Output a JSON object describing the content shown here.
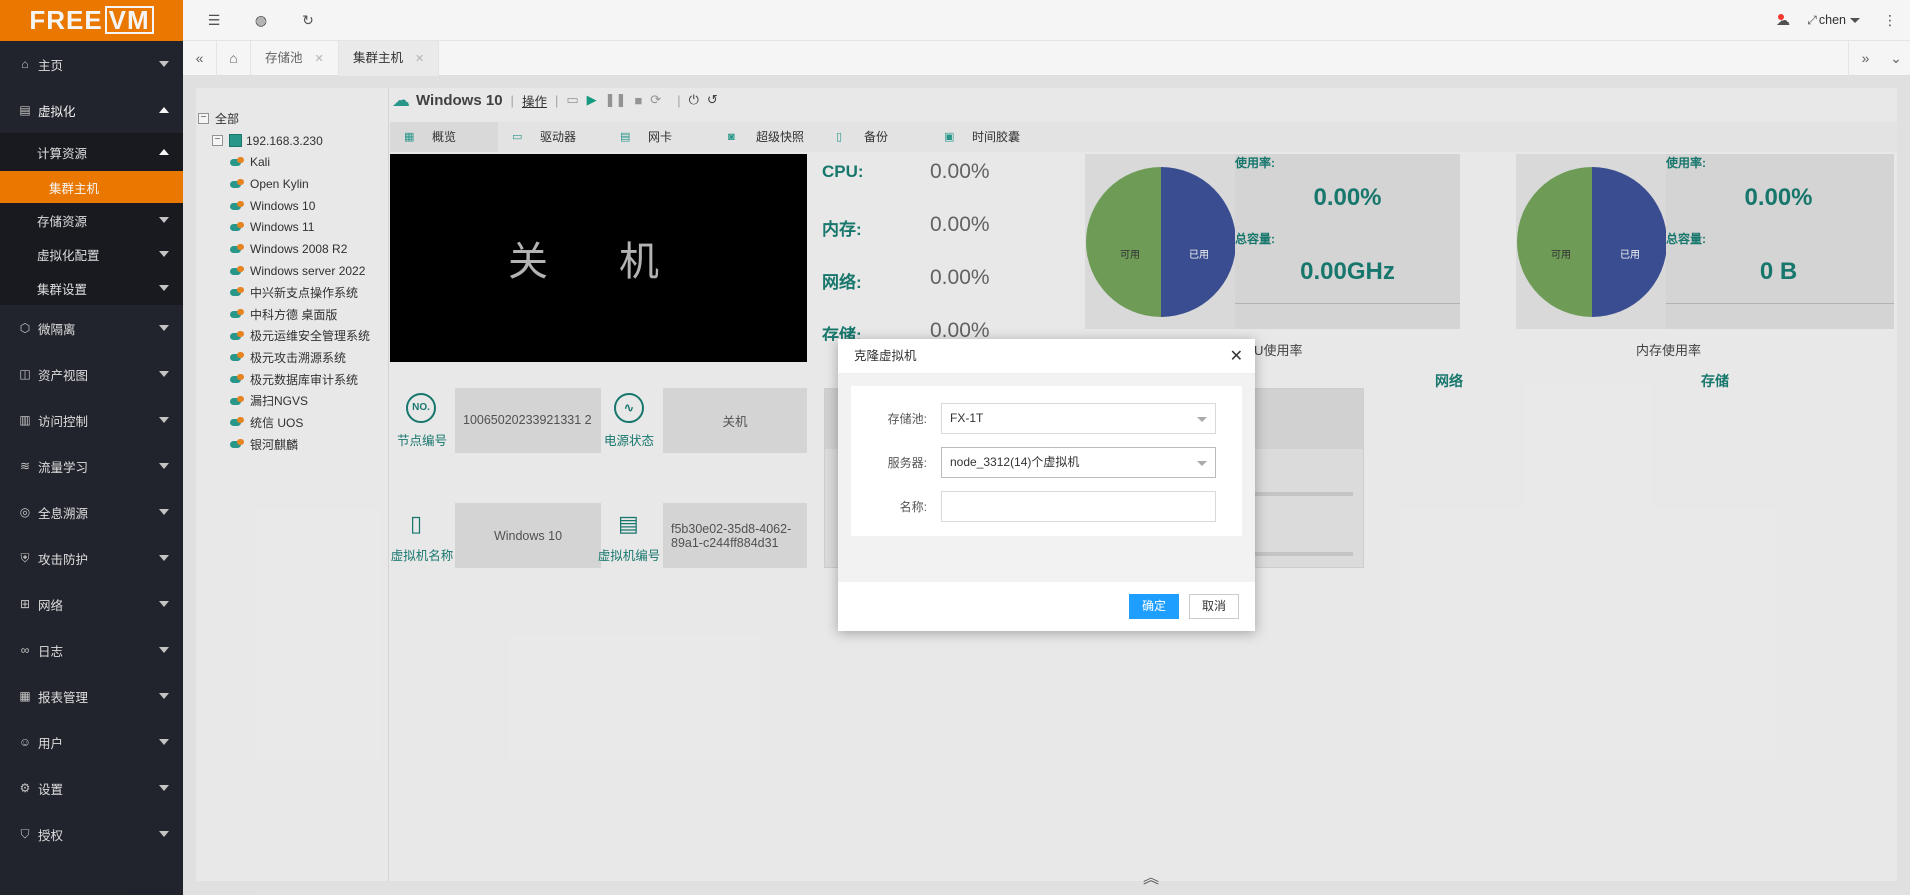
{
  "logo": {
    "free": "FREE",
    "vm": "VM"
  },
  "sidebar": {
    "items": [
      {
        "label": "主页"
      },
      {
        "label": "虚拟化"
      },
      {
        "label": "微隔离"
      },
      {
        "label": "资产视图"
      },
      {
        "label": "访问控制"
      },
      {
        "label": "流量学习"
      },
      {
        "label": "全息溯源"
      },
      {
        "label": "攻击防护"
      },
      {
        "label": "网络"
      },
      {
        "label": "日志"
      },
      {
        "label": "报表管理"
      },
      {
        "label": "用户"
      },
      {
        "label": "设置"
      },
      {
        "label": "授权"
      }
    ],
    "virt_sub": [
      {
        "label": "计算资源"
      },
      {
        "label": "存储资源"
      },
      {
        "label": "虚拟化配置"
      },
      {
        "label": "集群设置"
      }
    ],
    "compute_sub": [
      {
        "label": "集群主机"
      }
    ]
  },
  "topbar": {
    "user": "chen"
  },
  "tabs": [
    {
      "label": "存储池"
    },
    {
      "label": "集群主机"
    }
  ],
  "tree": {
    "root": "全部",
    "host": "192.168.3.230",
    "vms": [
      "Kali",
      "Open Kylin",
      "Windows 10",
      "Windows 11",
      "Windows 2008 R2",
      "Windows server 2022",
      "中兴新支点操作系统",
      "中科方德 桌面版",
      "极元运维安全管理系统",
      "极元攻击溯源系统",
      "极元数据库审计系统",
      "漏扫NGVS",
      "统信 UOS",
      "银河麒麟"
    ]
  },
  "vm": {
    "name": "Windows 10",
    "op": "操作",
    "subtabs": [
      "概览",
      "驱动器",
      "网卡",
      "超级快照",
      "备份",
      "时间胶囊"
    ],
    "screen_text": "关 机",
    "metrics": [
      {
        "k": "CPU:",
        "v": "0.00%"
      },
      {
        "k": "内存:",
        "v": "0.00%"
      },
      {
        "k": "网络:",
        "v": "0.00%"
      },
      {
        "k": "存储:",
        "v": "0.00%"
      }
    ],
    "cpu": {
      "usage_label": "使用率:",
      "usage": "0.00%",
      "cap_label": "总容量:",
      "cap": "0.00GHz",
      "avail": "可用",
      "used": "已用",
      "caption": "CPU使用率"
    },
    "mem": {
      "usage_label": "使用率:",
      "usage": "0.00%",
      "cap_label": "总容量:",
      "cap": "0 B",
      "avail": "可用",
      "used": "已用",
      "caption": "内存使用率"
    },
    "net_label": "网络",
    "storage_label": "存储",
    "node_label": "节点编号",
    "node_value": "10065020233921331 2",
    "power_label": "电源状态",
    "power_value": "关机",
    "vmname_label": "虚拟机名称",
    "vmname_value": "Windows 10",
    "vmid_label": "虚拟机编号",
    "vmid_value": "f5b30e02-35d8-4062-89a1-c244ff884d31"
  },
  "dialog": {
    "title": "克隆虚拟机",
    "pool_label": "存储池:",
    "pool_value": "FX-1T",
    "server_label": "服务器:",
    "server_value": "node_3312(14)个虚拟机",
    "name_label": "名称:",
    "name_value": "",
    "ok": "确定",
    "cancel": "取消"
  }
}
